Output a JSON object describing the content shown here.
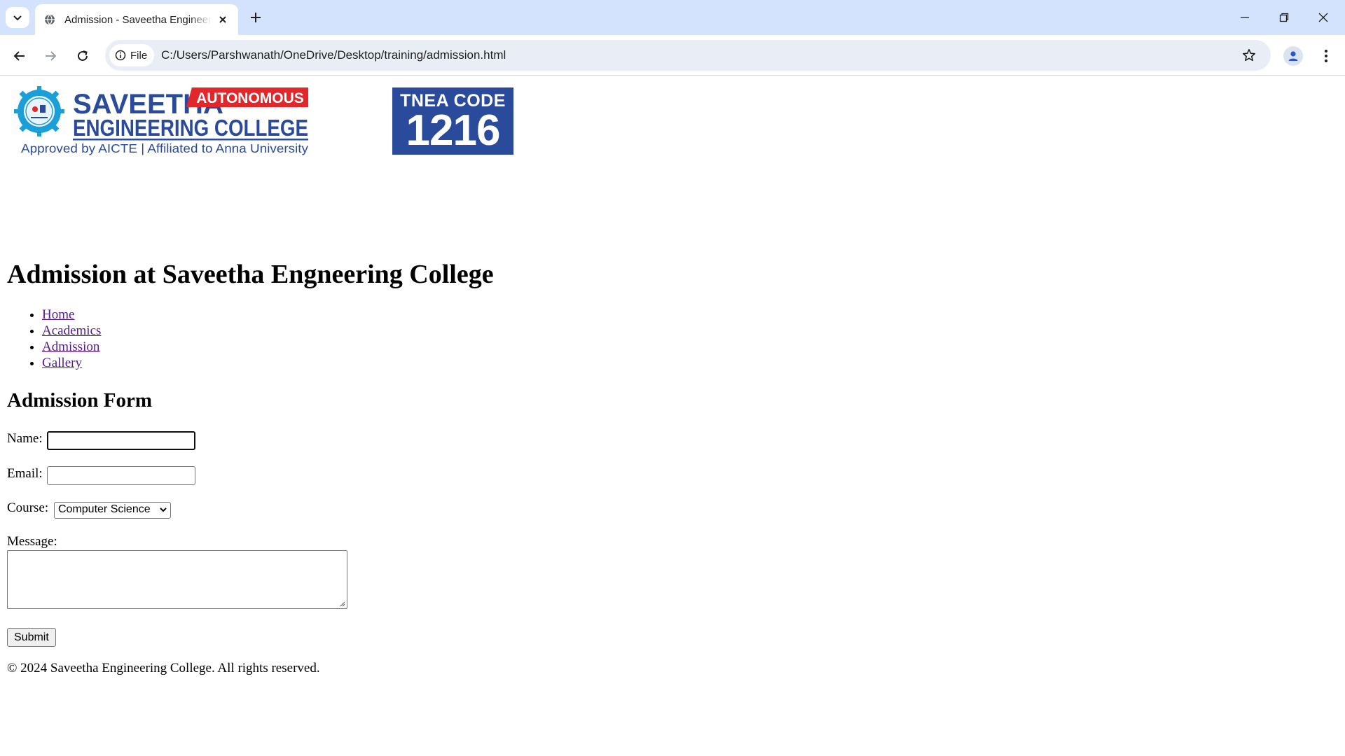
{
  "browser": {
    "tab_title": "Admission - Saveetha Engineering College",
    "site_chip_label": "File",
    "url": "C:/Users/Parshwanath/OneDrive/Desktop/training/admission.html"
  },
  "logo": {
    "college_name_line1": "SAVEETHA",
    "autonomous_badge": "AUTONOMOUS",
    "college_name_line2": "ENGINEERING COLLEGE",
    "tagline": "Approved by AICTE  |  Affiliated to Anna University",
    "tnea_label": "TNEA CODE",
    "tnea_code": "1216",
    "colors": {
      "blue": "#2a4b9b",
      "red": "#e2262a"
    }
  },
  "page": {
    "title": "Admission at Saveetha Engneering College",
    "nav": [
      "Home",
      "Academics",
      "Admission",
      "Gallery"
    ]
  },
  "form": {
    "title": "Admission Form",
    "name_label": "Name:",
    "name_value": "",
    "email_label": "Email:",
    "email_value": "",
    "course_label": "Course:",
    "course_selected": "Computer Science",
    "message_label": "Message:",
    "submit_label": "Submit"
  },
  "footer": {
    "text": "© 2024 Saveetha Engineering College. All rights reserved."
  }
}
